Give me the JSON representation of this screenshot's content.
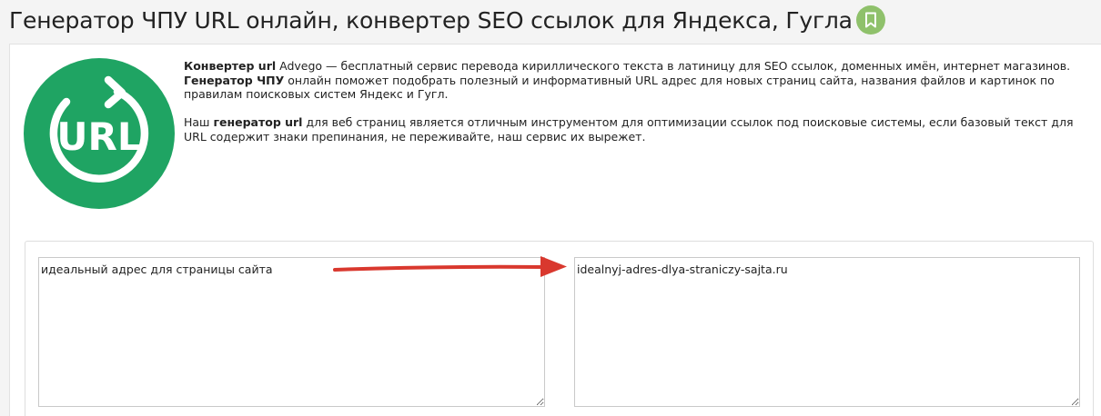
{
  "header": {
    "title": "Генератор ЧПУ URL онлайн, конвертер SEO ссылок для Яндекса, Гугла",
    "bookmark_icon": "bookmark-icon",
    "bookmark_color": "#8fc16b"
  },
  "logo": {
    "text": "URL",
    "color": "#1fa463"
  },
  "description": {
    "p1_b1": "Конвертер url",
    "p1_t1": " Advego — бесплатный сервис перевода кириллического текста в латиницу для SEO ссылок, доменных имён, интернет магазинов. ",
    "p1_b2": "Генератор ЧПУ",
    "p1_t2": " онлайн поможет подобрать полезный и информативный URL адрес для новых страниц сайта, названия файлов и картинок по правилам поисковых систем Яндекс и Гугл.",
    "p2_t1": "Наш ",
    "p2_b1": "генератор url",
    "p2_t2": " для веб страниц является отличным инструментом для оптимизации ссылок под поисковые системы, если базовый текст для URL содержит знаки препинания, не переживайте, наш сервис их вырежет."
  },
  "converter": {
    "input_value": "идеальный адрес для страницы сайта",
    "output_value": "idealnyj-adres-dlya-straniczy-sajta.ru",
    "arrow_color": "#d9382e"
  }
}
